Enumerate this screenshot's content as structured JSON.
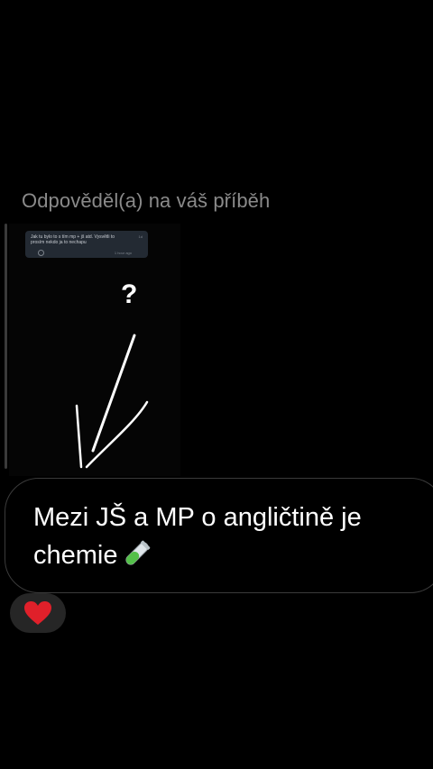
{
  "reply": {
    "header": "Odpověděl(a) na váš příběh"
  },
  "story": {
    "card_text": "Jak tu bylo to s tím mp + jš atd. Vysvětli to prosím nekdo ja to nechapu",
    "card_time": "1d",
    "card_footer": "1 hour ago",
    "question_mark": "?"
  },
  "message": {
    "text": "Mezi JŠ a MP o angličtině je chemie",
    "emoji_icon": "test-tube-icon"
  },
  "reaction": {
    "icon": "red-heart-icon",
    "color": "#e0202a"
  }
}
